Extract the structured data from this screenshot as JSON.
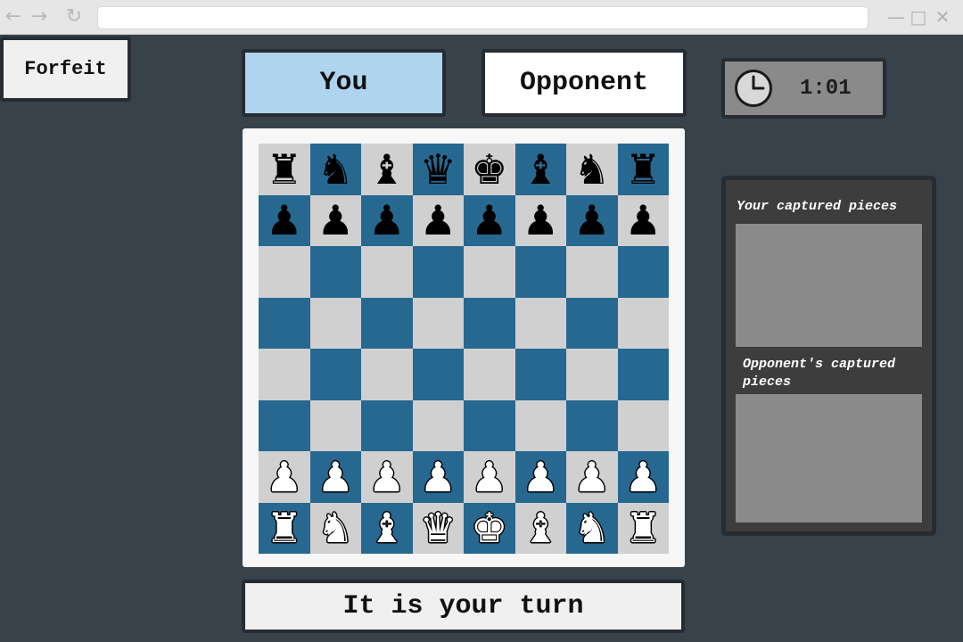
{
  "browser": {
    "back_icon": "arrow-left-icon",
    "forward_icon": "arrow-right-icon",
    "reload_icon": "reload-icon",
    "address": ""
  },
  "controls": {
    "forfeit_label": "Forfeit"
  },
  "players": {
    "you_label": "You",
    "opponent_label": "Opponent",
    "active": "you",
    "active_color": "#aed4f0"
  },
  "timer": {
    "icon": "clock-icon",
    "value": "1:01"
  },
  "board": {
    "light_color": "#d0d0d0",
    "dark_color": "#276891",
    "rows": [
      [
        "r",
        "n",
        "b",
        "q",
        "k",
        "b",
        "n",
        "r"
      ],
      [
        "p",
        "p",
        "p",
        "p",
        "p",
        "p",
        "p",
        "p"
      ],
      [
        "",
        "",
        "",
        "",
        "",
        "",
        "",
        ""
      ],
      [
        "",
        "",
        "",
        "",
        "",
        "",
        "",
        ""
      ],
      [
        "",
        "",
        "",
        "",
        "",
        "",
        "",
        ""
      ],
      [
        "",
        "",
        "",
        "",
        "",
        "",
        "",
        ""
      ],
      [
        "P",
        "P",
        "P",
        "P",
        "P",
        "P",
        "P",
        "P"
      ],
      [
        "R",
        "N",
        "B",
        "Q",
        "K",
        "B",
        "N",
        "R"
      ]
    ]
  },
  "status": {
    "message": "It is your turn"
  },
  "captured": {
    "yours_label": "Your captured pieces",
    "yours_pieces": [],
    "opponent_label": "Opponent's captured pieces",
    "opponent_pieces": []
  }
}
